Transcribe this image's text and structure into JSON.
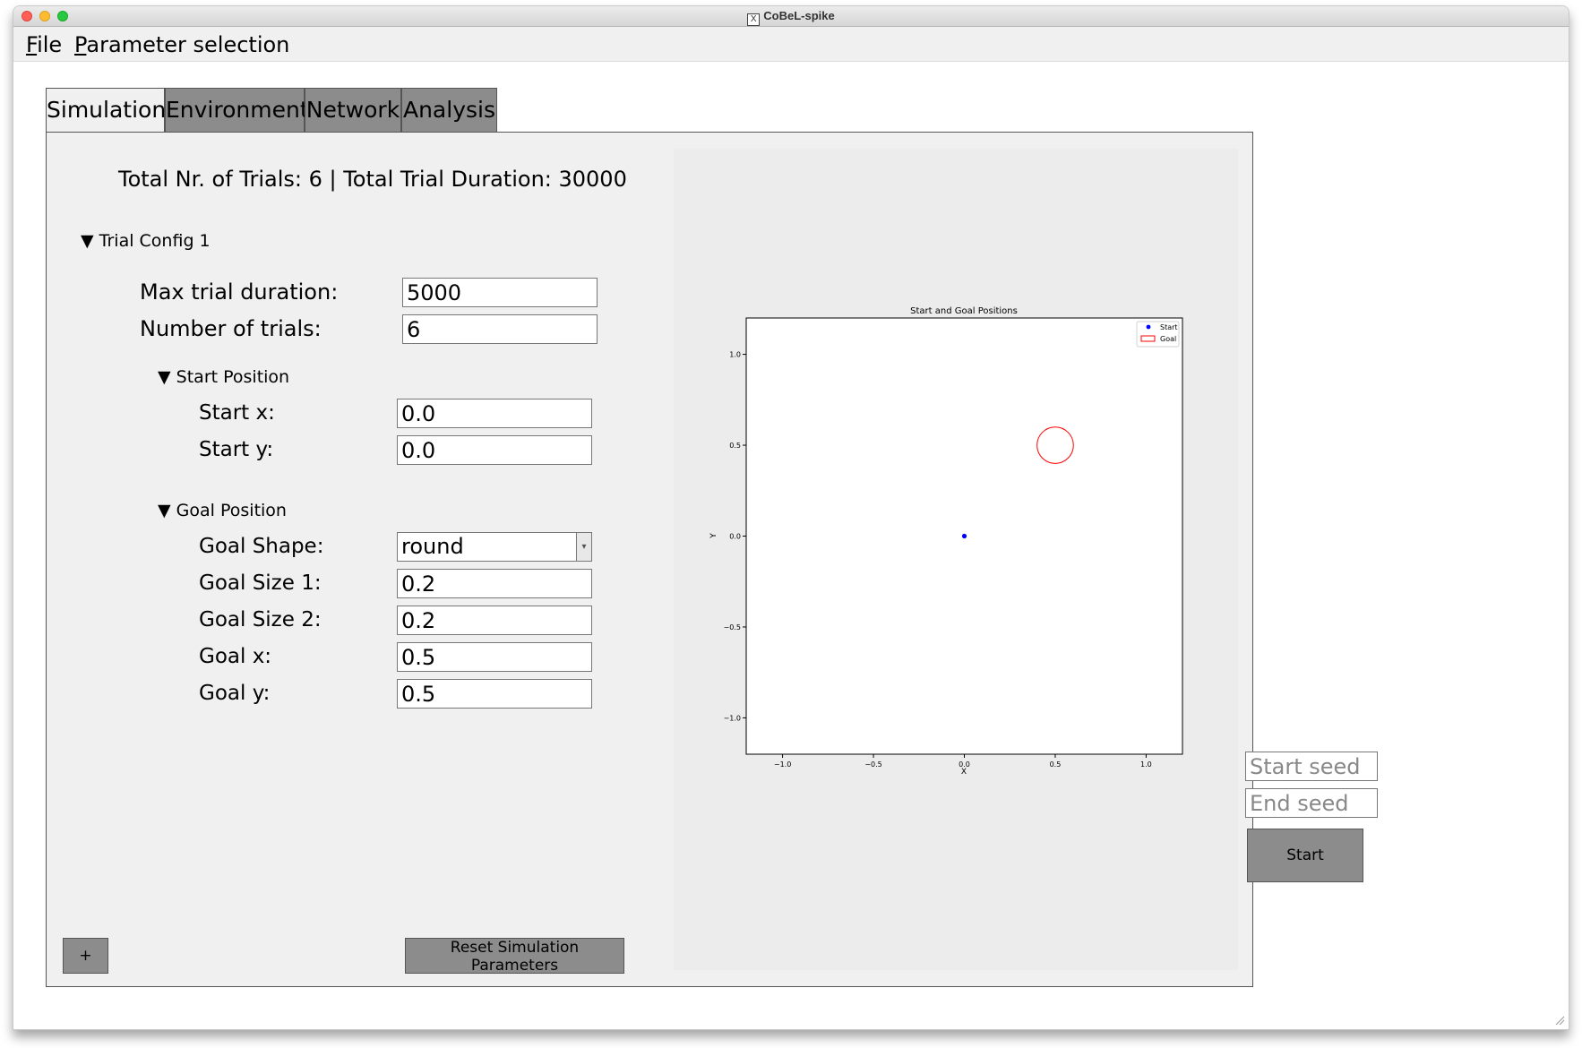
{
  "window": {
    "title": "CoBeL-spike"
  },
  "menu": [
    {
      "mnemonic": "F",
      "rest": "ile"
    },
    {
      "mnemonic": "P",
      "rest": "arameter selection"
    }
  ],
  "tabs": [
    "Simulation",
    "Environment",
    "Network",
    "Analysis"
  ],
  "active_tab": "Simulation",
  "summary": "Total Nr. of Trials: 6 | Total Trial Duration: 30000",
  "trial_config": {
    "header": "Trial Config 1",
    "max_duration_label": "Max trial duration:",
    "max_duration": "5000",
    "num_trials_label": "Number of trials:",
    "num_trials": "6",
    "start": {
      "header": "Start Position",
      "x_label": "Start x:",
      "x": "0.0",
      "y_label": "Start y:",
      "y": "0.0"
    },
    "goal": {
      "header": "Goal Position",
      "shape_label": "Goal Shape:",
      "shape": "round",
      "size1_label": "Goal Size 1:",
      "size1": "0.2",
      "size2_label": "Goal Size 2:",
      "size2": "0.2",
      "x_label": "Goal x:",
      "x": "0.5",
      "y_label": "Goal y:",
      "y": "0.5"
    }
  },
  "buttons": {
    "add": "+",
    "reset": "Reset Simulation Parameters",
    "start": "Start"
  },
  "seeds": {
    "start_placeholder": "Start seed",
    "end_placeholder": "End seed"
  },
  "icons": {
    "tree_expanded": "▼",
    "dropdown": "▾",
    "x11": "X"
  },
  "chart_data": {
    "type": "scatter",
    "title": "Start and Goal Positions",
    "xlabel": "X",
    "ylabel": "Y",
    "xlim": [
      -1.2,
      1.2
    ],
    "ylim": [
      -1.2,
      1.2
    ],
    "xticks": [
      -1.0,
      -0.5,
      0.0,
      0.5,
      1.0
    ],
    "yticks": [
      -1.0,
      -0.5,
      0.0,
      0.5,
      1.0
    ],
    "xtick_labels": [
      "−1.0",
      "−0.5",
      "0.0",
      "0.5",
      "1.0"
    ],
    "ytick_labels": [
      "−1.0",
      "−0.5",
      "0.0",
      "0.5",
      "1.0"
    ],
    "grid": false,
    "legend": "top-right",
    "series": [
      {
        "name": "Start",
        "marker": "dot",
        "color": "#0000ff",
        "points": [
          [
            0.0,
            0.0
          ]
        ]
      },
      {
        "name": "Goal",
        "marker": "circle",
        "color": "#ff0000",
        "center": [
          0.5,
          0.5
        ],
        "radius": 0.1
      }
    ]
  },
  "colors": {
    "panel_bg": "#f0f0f0",
    "button_bg": "#8c8c8c",
    "plot_bg": "#ececec",
    "start_marker": "#0000ff",
    "goal_marker": "#ff0000"
  }
}
